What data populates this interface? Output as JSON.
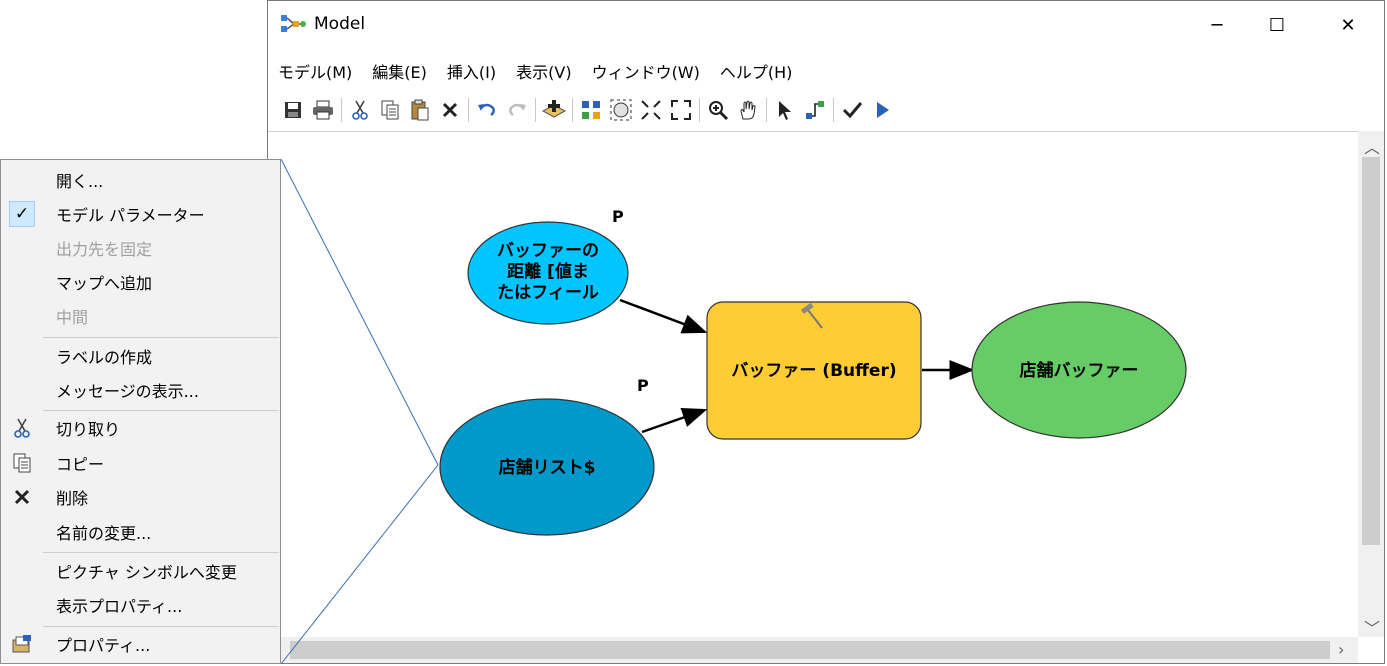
{
  "window": {
    "title": "Model",
    "controls": {
      "minimize": "─",
      "maximize": "☐",
      "close": "✕"
    }
  },
  "menubar": [
    "モデル(M)",
    "編集(E)",
    "挿入(I)",
    "表示(V)",
    "ウィンドウ(W)",
    "ヘルプ(H)"
  ],
  "toolbar": [
    "save-icon",
    "print-icon",
    "cut-icon",
    "copy-icon",
    "paste-icon",
    "delete-icon",
    "undo-icon",
    "redo-icon",
    "add-data-icon",
    "auto-layout-icon",
    "full-extent-icon",
    "fixed-zoom-in-icon",
    "fixed-zoom-out-icon",
    "zoom-in-icon",
    "pan-icon",
    "select-icon",
    "connect-icon",
    "validate-icon",
    "run-icon"
  ],
  "diagram": {
    "nodes": {
      "buffer_distance": {
        "label_lines": [
          "バッファーの",
          "距離 [値ま",
          "たはフィール"
        ],
        "param_marker": "P",
        "color": "#00c5ff"
      },
      "store_list": {
        "label": "店舗リスト$",
        "param_marker": "P",
        "color": "#0099c9"
      },
      "buffer_tool": {
        "label": "バッファー (Buffer)",
        "color": "#ffcc33"
      },
      "store_buffer": {
        "label": "店舗バッファー",
        "color": "#66cc66"
      }
    }
  },
  "context_menu": {
    "items": [
      {
        "label": "開く...",
        "icon": "",
        "disabled": false
      },
      {
        "label": "モデル パラメーター",
        "icon": "checkmark-icon",
        "disabled": false
      },
      {
        "label": "出力先を固定",
        "icon": "",
        "disabled": true
      },
      {
        "label": "マップへ追加",
        "icon": "",
        "disabled": false
      },
      {
        "label": "中間",
        "icon": "",
        "disabled": true
      },
      {
        "label": "ラベルの作成",
        "icon": "",
        "disabled": false
      },
      {
        "label": "メッセージの表示...",
        "icon": "",
        "disabled": false
      },
      {
        "label": "切り取り",
        "icon": "cut-icon",
        "disabled": false
      },
      {
        "label": "コピー",
        "icon": "copy-icon",
        "disabled": false
      },
      {
        "label": "削除",
        "icon": "delete-icon",
        "disabled": false
      },
      {
        "label": "名前の変更...",
        "icon": "",
        "disabled": false
      },
      {
        "label": "ピクチャ シンボルへ変更",
        "icon": "",
        "disabled": false
      },
      {
        "label": "表示プロパティ...",
        "icon": "",
        "disabled": false
      },
      {
        "label": "プロパティ...",
        "icon": "properties-icon",
        "disabled": false
      }
    ]
  }
}
